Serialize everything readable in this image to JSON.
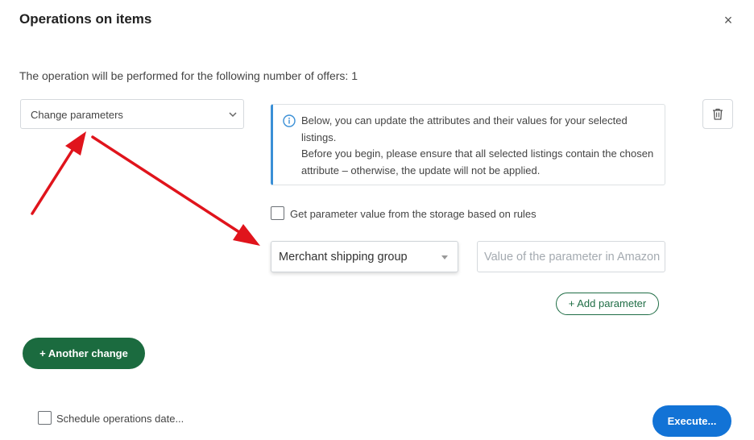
{
  "dialog": {
    "title": "Operations on items",
    "close_symbol": "×",
    "offers_text": "The operation will be performed for the following number of offers:",
    "offers_count": "1"
  },
  "operation_select": {
    "value": "Change parameters",
    "icon": "chevron-down-icon"
  },
  "info_box": {
    "line1": "Below, you can update the attributes and their values for your selected listings.",
    "line2": "Before you begin, please ensure that all selected listings contain the chosen attribute – otherwise, the update will not be applied.",
    "icon": "info-icon",
    "accent_color": "#3a8fd6"
  },
  "delete_button": {
    "icon": "trash-icon"
  },
  "storage_checkbox": {
    "label": "Get parameter value from the storage based on rules",
    "checked": false
  },
  "parameter_select": {
    "value": "Merchant shipping group"
  },
  "parameter_value_input": {
    "value": "",
    "placeholder": "Value of the parameter in Amazon"
  },
  "add_parameter_button": {
    "label": "Add parameter",
    "icon": "plus-icon"
  },
  "another_change_button": {
    "label": "Another change",
    "icon": "plus-icon",
    "color": "#1b6b3f"
  },
  "schedule_checkbox": {
    "label": "Schedule operations date...",
    "checked": false
  },
  "execute_button": {
    "label": "Execute...",
    "color": "#1273d6"
  },
  "annotations": {
    "arrow_color": "#e0141c"
  }
}
